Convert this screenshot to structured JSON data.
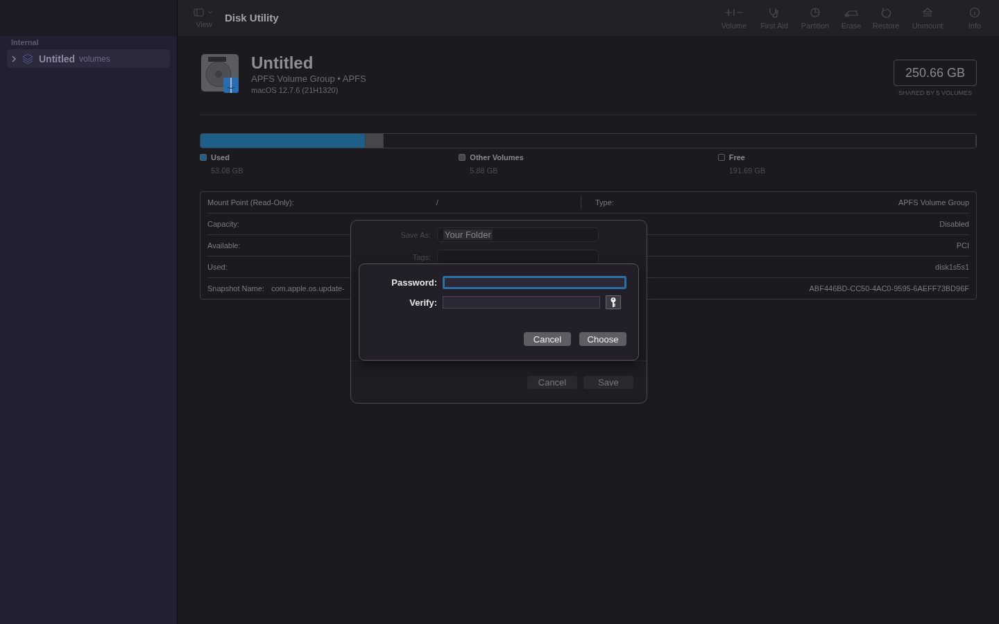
{
  "window": {
    "title": "Disk Utility"
  },
  "sidebar": {
    "section": "Internal",
    "items": [
      {
        "name": "Untitled",
        "detail": "volumes",
        "selected": true,
        "expanded": false
      }
    ]
  },
  "toolbar": {
    "view_label": "View",
    "items": [
      {
        "kind": "volume",
        "label": "Volume"
      },
      {
        "kind": "firstaid",
        "label": "First Aid"
      },
      {
        "kind": "partition",
        "label": "Partition"
      },
      {
        "kind": "erase",
        "label": "Erase"
      },
      {
        "kind": "restore",
        "label": "Restore"
      },
      {
        "kind": "unmount",
        "label": "Unmount"
      },
      {
        "kind": "info",
        "label": "Info"
      }
    ]
  },
  "volume": {
    "name": "Untitled",
    "subtitle": "APFS Volume Group • APFS",
    "os": "macOS 12.7.6 (21H1320)",
    "size": "250.66 GB",
    "size_note": "SHARED BY 5 VOLUMES"
  },
  "usage": [
    {
      "label": "Used",
      "value": "53.08 GB",
      "level": 0.2126,
      "color": "#1e5f8a"
    },
    {
      "label": "Other Volumes",
      "value": "5.88 GB",
      "level": 0.0225,
      "color": "#48474c"
    },
    {
      "label": "Free",
      "value": "191.69 GB",
      "level": 0.765,
      "color": "#1c1b20"
    }
  ],
  "info_left": [
    {
      "label": "Mount Point (Read-Only):",
      "value": "/"
    },
    {
      "label": "Capacity:"
    },
    {
      "label": "Available:"
    },
    {
      "label": "Used:"
    },
    {
      "label": "Snapshot Name:",
      "value": "com.apple.os.update-"
    }
  ],
  "info_right": [
    {
      "label": "Type:",
      "value": "APFS Volume Group"
    },
    {
      "value": "Disabled"
    },
    {
      "value": "PCI"
    },
    {
      "value": "disk1s5s1"
    },
    {
      "value": "ABF446BD-CC50-4AC0-9595-6AEFF73BD96F"
    }
  ],
  "save_sheet": {
    "save_as_label": "Save As:",
    "save_as_value": "Your Folder",
    "tags_label": "Tags:",
    "buttons": [
      {
        "label": "Cancel",
        "disabled": true
      },
      {
        "label": "Save",
        "disabled": true
      }
    ]
  },
  "password_sheet": {
    "password_label": "Password:",
    "verify_label": "Verify:",
    "buttons": [
      {
        "label": "Cancel"
      },
      {
        "label": "Choose"
      }
    ]
  }
}
